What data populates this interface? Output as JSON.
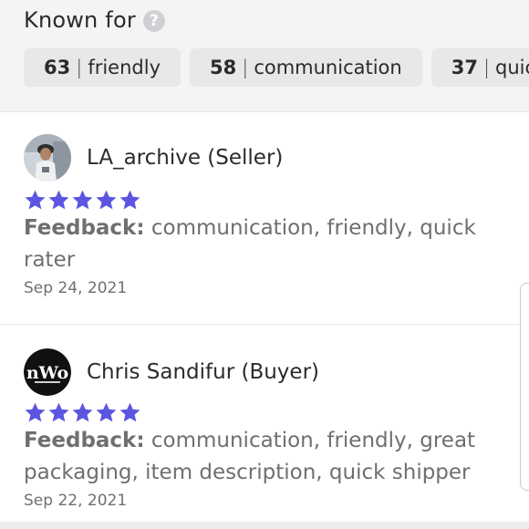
{
  "known_for": {
    "title": "Known for",
    "help_icon": "question-circle-icon",
    "tags": [
      {
        "count": "63",
        "label": "friendly"
      },
      {
        "count": "58",
        "label": "communication"
      },
      {
        "count": "37",
        "label": "quick"
      }
    ]
  },
  "reviews": [
    {
      "reviewer": "LA_archive (Seller)",
      "avatar": "user-photo-avatar",
      "rating": 5,
      "feedback_label": "Feedback:",
      "feedback_text": "communication, friendly, quick rater",
      "date": "Sep 24, 2021"
    },
    {
      "reviewer": "Chris Sandifur (Buyer)",
      "avatar": "nwo-logo-avatar",
      "avatar_text": "nWo",
      "rating": 5,
      "feedback_label": "Feedback:",
      "feedback_text": "communication, friendly, great packaging, item description, quick shipper",
      "date": "Sep 22, 2021"
    }
  ],
  "colors": {
    "star": "#5b55e0",
    "section_bg": "#f4f4f5",
    "tag_bg": "#e8e8eb",
    "muted_text": "#6f6f6f"
  }
}
